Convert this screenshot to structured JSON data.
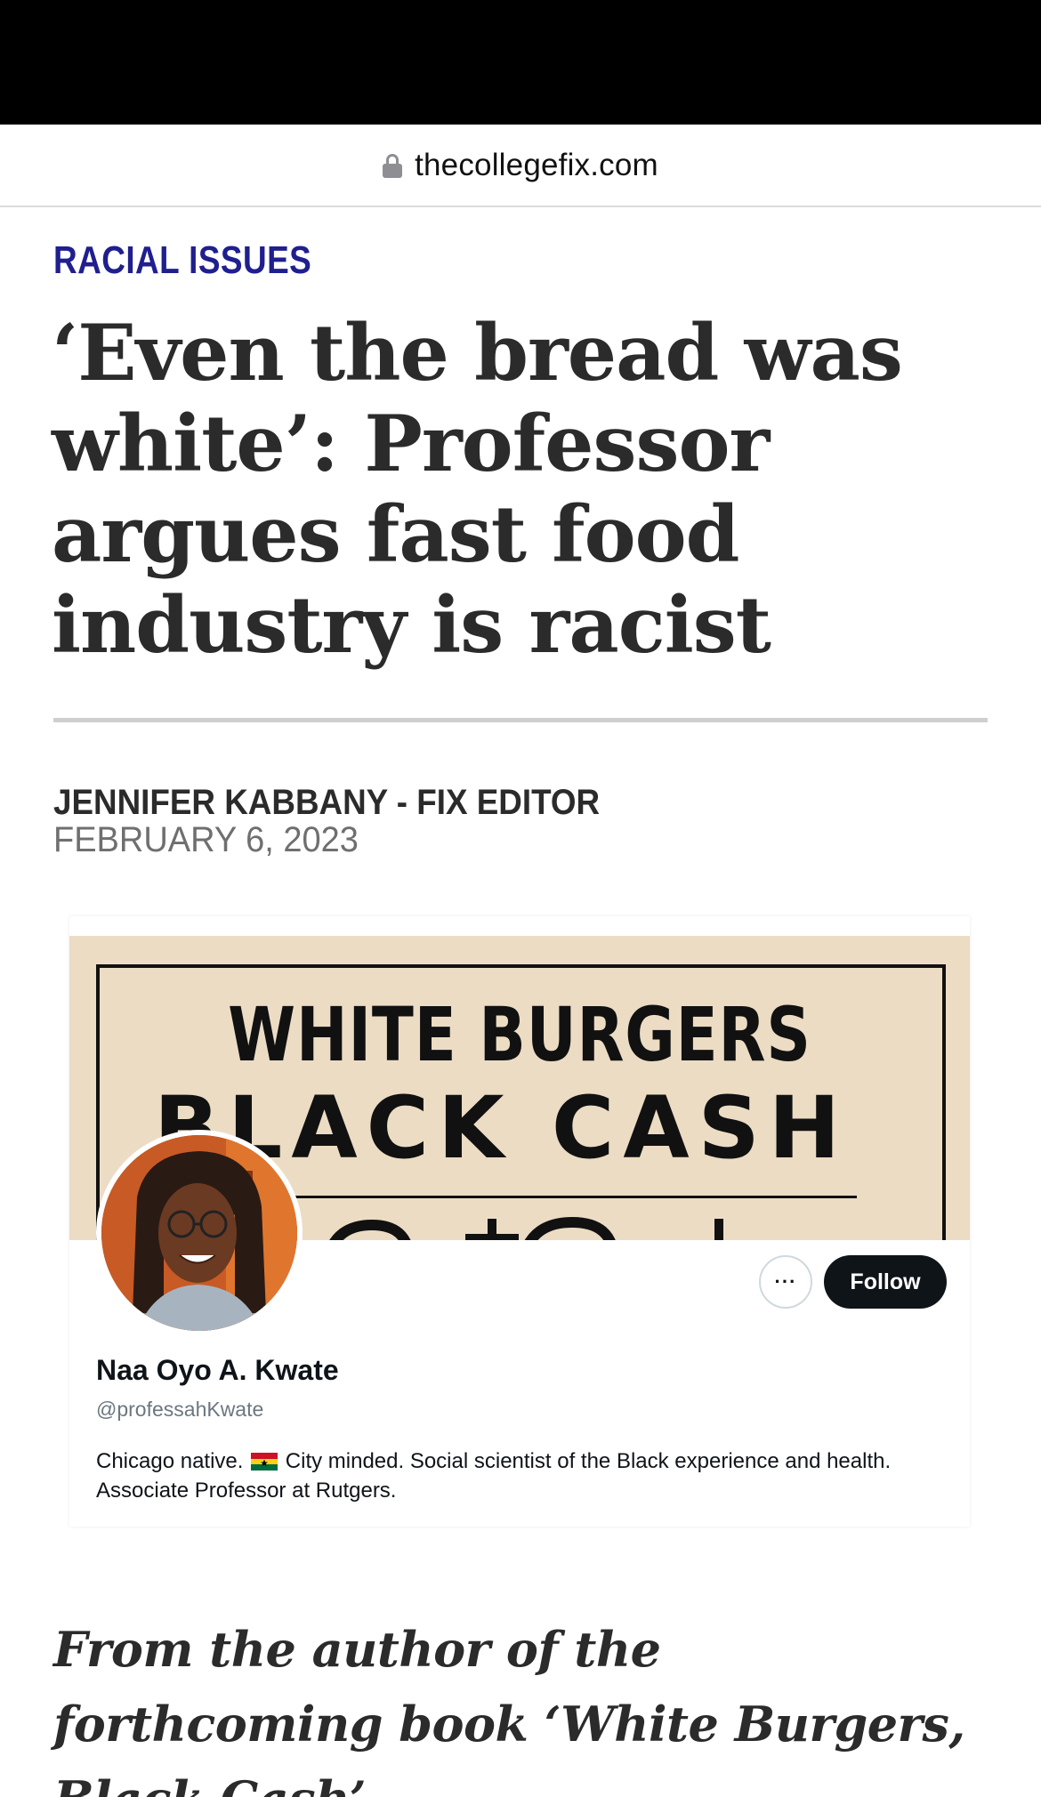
{
  "browser": {
    "url": "thecollegefix.com"
  },
  "article": {
    "category": "RACIAL ISSUES",
    "headline": "‘Even the bread was white’: Professor argues fast food industry is racist",
    "byline": "JENNIFER KABBANY - FIX EDITOR",
    "date": "FEBRUARY 6, 2023",
    "dek": "From the author of the forthcoming book ‘White Burgers, Black Cash’"
  },
  "embed": {
    "banner": {
      "title_line1": "WHITE BURGERS",
      "title_line2": "BLACK CASH",
      "background_color": "#ecdcc4"
    },
    "profile": {
      "name": "Naa Oyo A. Kwate",
      "handle": "@professahKwate",
      "bio_before_flag": "Chicago native. ",
      "bio_after_flag": " City minded. Social scientist of the Black experience and health. Associate Professor at Rutgers.",
      "flag_icon": "ghana-flag-icon",
      "more_label": "···",
      "follow_label": "Follow"
    }
  },
  "colors": {
    "category": "#1f1f8f",
    "headline": "#2b2b2b",
    "follow_button": "#0f1419"
  }
}
